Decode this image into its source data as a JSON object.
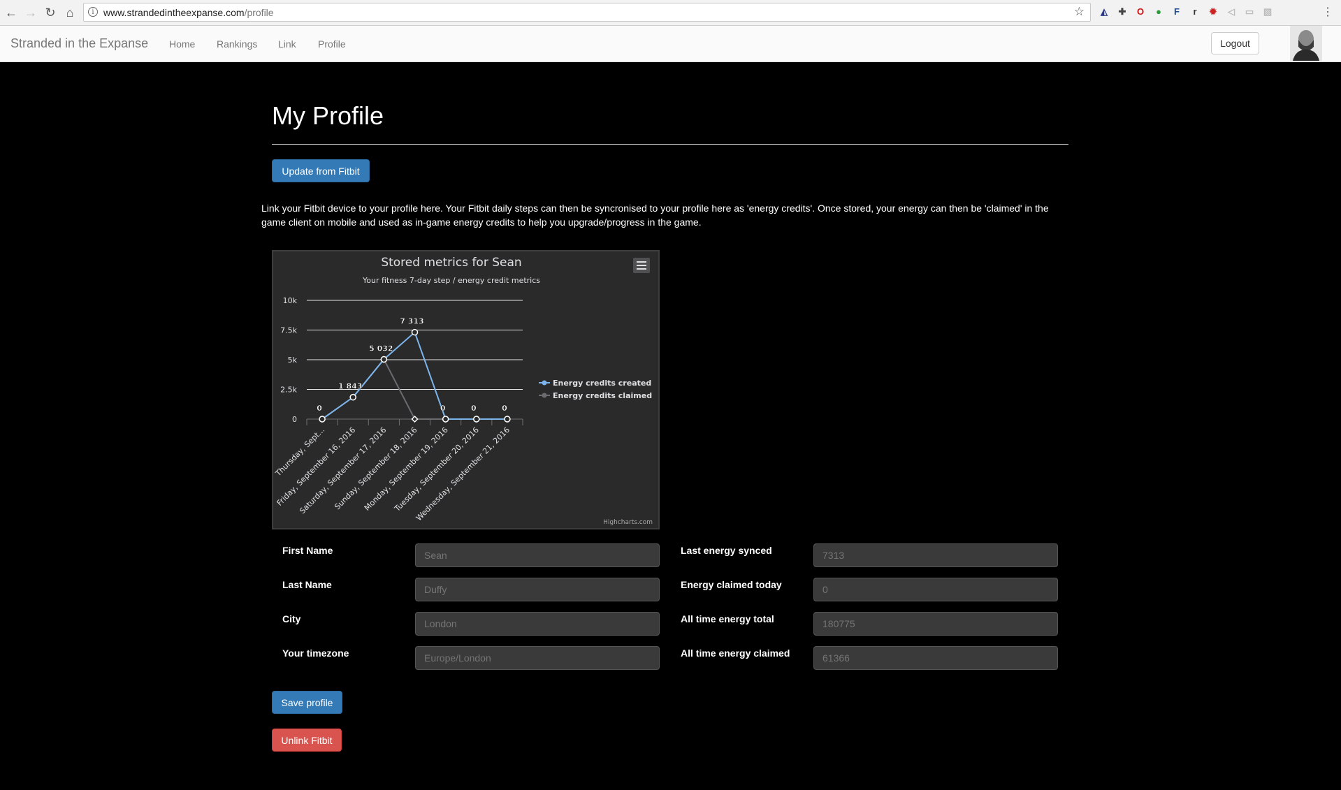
{
  "browser": {
    "url_domain": "www.strandedintheexpanse.com",
    "url_path": "/profile",
    "info_glyph": "i",
    "extensions": [
      {
        "icon": "extension-blue-icon",
        "glyph": "◭",
        "color": "#2a3a8a"
      },
      {
        "icon": "extension-puzzle-icon",
        "glyph": "✚",
        "color": "#444444"
      },
      {
        "icon": "opera-icon",
        "glyph": "O",
        "color": "#cc1111"
      },
      {
        "icon": "extension-green-icon",
        "glyph": "●",
        "color": "#2a9a3a"
      },
      {
        "icon": "extension-f-icon",
        "glyph": "F",
        "color": "#1a4a8a"
      },
      {
        "icon": "extension-r-icon",
        "glyph": "r",
        "color": "#333333"
      },
      {
        "icon": "extension-gear-icon",
        "glyph": "✹",
        "color": "#cc2222"
      },
      {
        "icon": "extension-gray-icon",
        "glyph": "◁",
        "color": "#bbbbbb"
      },
      {
        "icon": "extension-card-icon",
        "glyph": "▭",
        "color": "#bbbbbb"
      },
      {
        "icon": "extension-image-icon",
        "glyph": "▨",
        "color": "#bbbbbb"
      }
    ]
  },
  "navbar": {
    "brand": "Stranded in the Expanse",
    "links": [
      "Home",
      "Rankings",
      "Link",
      "Profile"
    ],
    "logout": "Logout"
  },
  "page": {
    "title": "My Profile",
    "update_button": "Update from Fitbit",
    "intro": "Link your Fitbit device to your profile here. Your Fitbit daily steps can then be syncronised to your profile here as 'energy credits'. Once stored, your energy can then be 'claimed' in the game client on mobile and used as in-game energy credits to help you upgrade/progress in the game.",
    "save_button": "Save profile",
    "unlink_button": "Unlink Fitbit"
  },
  "form": {
    "left": [
      {
        "label": "First Name",
        "value": "Sean"
      },
      {
        "label": "Last Name",
        "value": "Duffy"
      },
      {
        "label": "City",
        "value": "London"
      },
      {
        "label": "Your timezone",
        "value": "Europe/London"
      }
    ],
    "right": [
      {
        "label": "Last energy synced",
        "value": "7313"
      },
      {
        "label": "Energy claimed today",
        "value": "0"
      },
      {
        "label": "All time energy total",
        "value": "180775"
      },
      {
        "label": "All time energy claimed",
        "value": "61366"
      }
    ]
  },
  "chart_data": {
    "type": "line",
    "title": "Stored metrics for Sean",
    "subtitle": "Your fitness 7-day step / energy credit metrics",
    "credits": "Highcharts.com",
    "categories": [
      "Thursday, Sept...",
      "Friday, September 16, 2016",
      "Saturday, September 17, 2016",
      "Sunday, September 18, 2016",
      "Monday, September 19, 2016",
      "Tuesday, September 20, 2016",
      "Wednesday, September 21, 2016"
    ],
    "yticks": [
      "0",
      "2.5k",
      "5k",
      "7.5k",
      "10k"
    ],
    "ylim": [
      0,
      10000
    ],
    "grid": true,
    "legend_position": "right",
    "series": [
      {
        "name": "Energy credits created",
        "color": "#7cb5ec",
        "values": [
          0,
          1843,
          5032,
          7313,
          0,
          0,
          0
        ],
        "labels": [
          "0",
          "1 843",
          "5 032",
          "7 313",
          "0",
          "0",
          "0"
        ]
      },
      {
        "name": "Energy credits claimed",
        "color": "#434348",
        "values": [
          0,
          1843,
          5032,
          0,
          0,
          0,
          0
        ],
        "labels": [
          "0",
          "1 843",
          "5 032",
          "0",
          "0",
          "0",
          "0"
        ]
      }
    ]
  }
}
